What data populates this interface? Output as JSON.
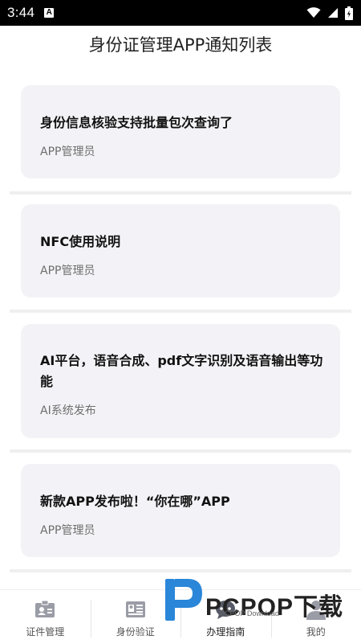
{
  "status_bar": {
    "time": "3:44",
    "notification_letter": "A"
  },
  "page": {
    "title": "身份证管理APP通知列表"
  },
  "notices": [
    {
      "title": "身份信息核验支持批量包次查询了",
      "author": "APP管理员"
    },
    {
      "title": "NFC使用说明",
      "author": "APP管理员"
    },
    {
      "title": "AI平台，语音合成、pdf文字识别及语音输出等功能",
      "author": "AI系统发布"
    },
    {
      "title": "新款APP发布啦！“你在哪”APP",
      "author": "APP管理员"
    }
  ],
  "bottom_nav": {
    "items": [
      {
        "label": "证件管理",
        "icon": "id-card-icon"
      },
      {
        "label": "身份验证",
        "icon": "id-verify-icon"
      },
      {
        "label": "办理指南",
        "icon": "chat-bubble-icon"
      },
      {
        "label": "我的",
        "icon": "user-icon"
      }
    ]
  },
  "watermark": {
    "brand": "PCPOP下载",
    "sub": "PCPOP Download"
  },
  "colors": {
    "card_bg": "#f3f3f7",
    "status_bar": "#000000",
    "text_primary": "#111111",
    "text_secondary": "#6e6e6e",
    "watermark_blue": "#2a86d8"
  }
}
